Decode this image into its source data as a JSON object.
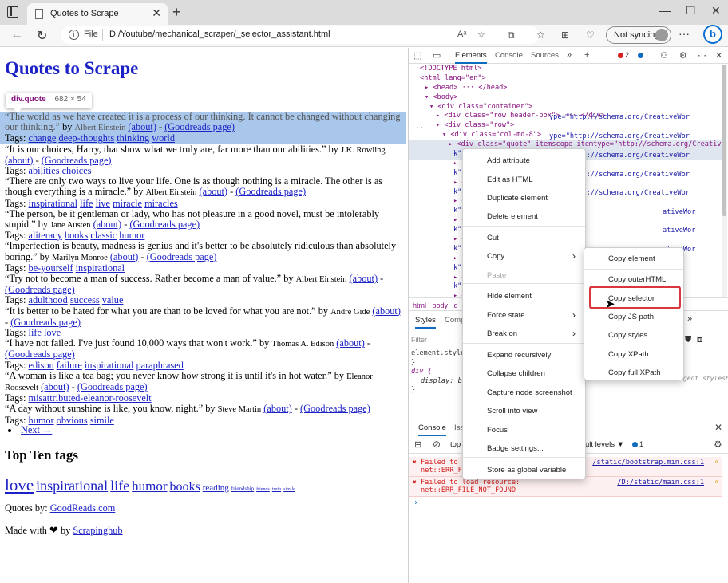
{
  "browser": {
    "tab_title": "Quotes to Scrape",
    "tab_close": "✕",
    "new_tab": "+",
    "win_min": "—",
    "win_max": "☐",
    "win_close": "✕",
    "back": "←",
    "forward": "→",
    "refresh": "↻",
    "address_scheme": "File",
    "address_url": "D:/Youtube/mechanical_scraper/_selector_assistant.html",
    "read_aloud": "Aᵃ",
    "sync_label": "Not syncing",
    "more": "···",
    "bing": "b"
  },
  "page": {
    "title": "Quotes to Scrape",
    "inspect_tooltip": {
      "selector": "div.quote",
      "size": "682 × 54"
    },
    "quotes": [
      {
        "text": "“The world as we have created it is a process of our thinking. It cannot be changed without changing our thinking.”",
        "author": "Albert Einstein",
        "tags": [
          "change",
          "deep-thoughts",
          "thinking",
          "world"
        ]
      },
      {
        "text": "“It is our choices, Harry, that show what we truly are, far more than our abilities.”",
        "author": "J.K. Rowling",
        "tags": [
          "abilities",
          "choices"
        ]
      },
      {
        "text": "“There are only two ways to live your life. One is as though nothing is a miracle. The other is as though everything is a miracle.”",
        "author": "Albert Einstein",
        "tags": [
          "inspirational",
          "life",
          "live",
          "miracle",
          "miracles"
        ]
      },
      {
        "text": "“The person, be it gentleman or lady, who has not pleasure in a good novel, must be intolerably stupid.”",
        "author": "Jane Austen",
        "tags": [
          "aliteracy",
          "books",
          "classic",
          "humor"
        ]
      },
      {
        "text": "“Imperfection is beauty, madness is genius and it's better to be absolutely ridiculous than absolutely boring.”",
        "author": "Marilyn Monroe",
        "tags": [
          "be-yourself",
          "inspirational"
        ]
      },
      {
        "text": "“Try not to become a man of success. Rather become a man of value.”",
        "author": "Albert Einstein",
        "tags": [
          "adulthood",
          "success",
          "value"
        ]
      },
      {
        "text": "“It is better to be hated for what you are than to be loved for what you are not.”",
        "author": "André Gide",
        "tags": [
          "life",
          "love"
        ]
      },
      {
        "text": "“I have not failed. I've just found 10,000 ways that won't work.”",
        "author": "Thomas A. Edison",
        "tags": [
          "edison",
          "failure",
          "inspirational",
          "paraphrased"
        ]
      },
      {
        "text": "“A woman is like a tea bag; you never know how strong it is until it's in hot water.”",
        "author": "Eleanor Roosevelt",
        "tags": [
          "misattributed-eleanor-roosevelt"
        ]
      },
      {
        "text": "“A day without sunshine is like, you know, night.”",
        "author": "Steve Martin",
        "tags": [
          "humor",
          "obvious",
          "simile"
        ]
      }
    ],
    "by": "by",
    "about_link": "(about)",
    "dash": "-",
    "goodreads_link": "(Goodreads page)",
    "tags_label": "Tags:",
    "next_link": "Next →",
    "top_tags_title": "Top Ten tags",
    "top_tags": [
      "love",
      "inspirational",
      "life",
      "humor",
      "books",
      "reading",
      "friendship",
      "friends",
      "truth",
      "simile"
    ],
    "quotes_by_label": "Quotes by:",
    "quotes_by_link": "GoodReads.com",
    "made_with_label": "Made with",
    "heart": "❤",
    "made_by_label": "by",
    "made_by_link": "Scrapinghub"
  },
  "devtools": {
    "tabs": [
      "Elements",
      "Console",
      "Sources"
    ],
    "more_tabs": "»",
    "add_tab": "+",
    "errors_count": "2",
    "issues_count": "1",
    "dom_lines": [
      "<!DOCTYPE html>",
      "<html lang=\"en\">",
      "▸ <head> ··· </head>",
      "▾ <body>",
      "▾ <div class=\"container\">",
      "▸ <div class=\"row header-box\"> ··· </div>",
      "▾ <div class=\"row\">",
      "▾ <div class=\"col-md-8\">",
      "▸ <div class=\"quote\" itemscope itemtype=\"http://schema.org/CreativeWor",
      "k\"",
      "▸ <d",
      "k\"",
      "▸ <d",
      "k\"",
      "▸ <d",
      "k\"",
      "▸ <d",
      "k\"",
      "▸ <d",
      "k\"",
      "▸ <d",
      "k\"",
      "▸ <d",
      "k\"",
      "▸ <d"
    ],
    "dom_overflow_tail": [
      "ype=\"http://schema.org/CreativeWor",
      "ype=\"http://schema.org/CreativeWor",
      "ype=\"http://schema.org/CreativeWor",
      "ype=\"http://schema.org/CreativeWor",
      "ype=\"http://schema.org/CreativeWor",
      "ativeWor",
      "ativeWor",
      "ativeWor"
    ],
    "dom_dots": "···",
    "breadcrumb": [
      "html",
      "body",
      "d"
    ],
    "styles_tabs": [
      "Styles",
      "Comp"
    ],
    "styles_more": "»",
    "filter_placeholder": "Filter",
    "styles_lines": [
      "element.style {",
      "}",
      "div {",
      "display: bl",
      "}"
    ],
    "styles_source": "user agent stylesheet",
    "console_tabs": [
      "Console",
      "Iss"
    ],
    "console_top": "top",
    "console_levels": "ult levels ▼",
    "console_issues": "1",
    "console_errors": [
      {
        "text": "Failed to l",
        "text2": "net::ERR_FI",
        "src": "/static/bootstrap.min.css:1"
      },
      {
        "text": "Failed to load resource:",
        "text2": "net::ERR_FILE_NOT_FOUND",
        "src": "/D:/static/main.css:1"
      }
    ],
    "prompt": "›"
  },
  "context_menu": {
    "items": [
      "Add attribute",
      "Edit as HTML",
      "Duplicate element",
      "Delete element",
      "Cut",
      "Copy",
      "Paste",
      "Hide element",
      "Force state",
      "Break on",
      "Expand recursively",
      "Collapse children",
      "Capture node screenshot",
      "Scroll into view",
      "Focus",
      "Badge settings...",
      "Store as global variable"
    ],
    "submenu_arrow": "›"
  },
  "copy_submenu": {
    "items": [
      "Copy element",
      "Copy outerHTML",
      "Copy selector",
      "Copy JS path",
      "Copy styles",
      "Copy XPath",
      "Copy full XPath"
    ]
  },
  "colors": {
    "highlight": "#a9c7ea",
    "link": "#1c22c6",
    "accent": "#0f6cbd",
    "callout": "#d9363e"
  }
}
